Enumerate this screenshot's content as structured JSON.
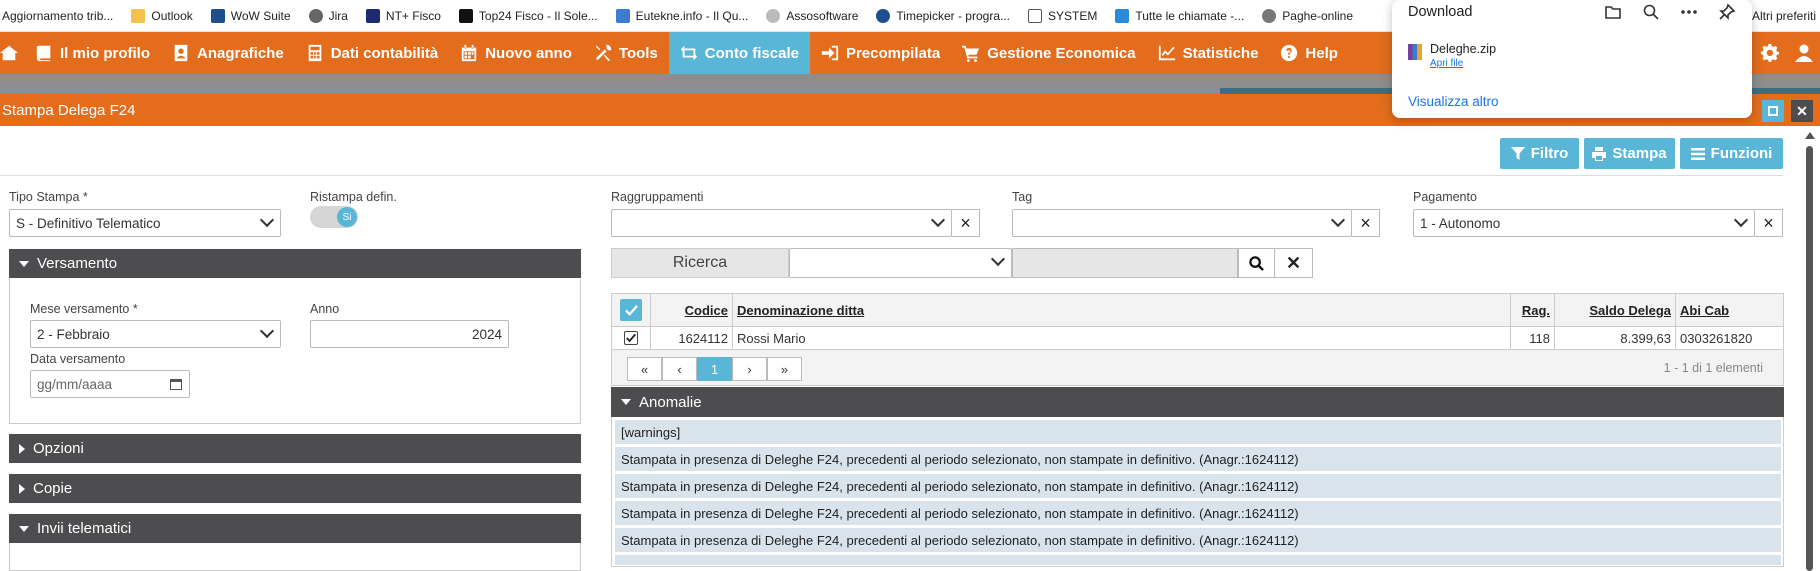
{
  "bookmarks": [
    {
      "label": "Aggiornamento trib...",
      "icon": "none",
      "color": "#ffffff"
    },
    {
      "label": "Outlook",
      "icon": "folder-icon",
      "color": "#f2c14e"
    },
    {
      "label": "WoW Suite",
      "icon": "wow-icon",
      "color": "#1e4e8c"
    },
    {
      "label": "Jira",
      "icon": "globe-icon",
      "color": "#666666"
    },
    {
      "label": "NT+ Fisco",
      "icon": "nt-icon",
      "color": "#1e2a6e"
    },
    {
      "label": "Top24 Fisco - Il Sole...",
      "icon": "sole-icon",
      "color": "#111111"
    },
    {
      "label": "Eutekne.info - Il Qu...",
      "icon": "eutekne-icon",
      "color": "#3d7bd1"
    },
    {
      "label": "Assosoftware",
      "icon": "globe-icon",
      "color": "#999999"
    },
    {
      "label": "Timepicker - progra...",
      "icon": "clock-icon",
      "color": "#1e4e8c"
    },
    {
      "label": "SYSTEM",
      "icon": "doc-icon",
      "color": "#555555"
    },
    {
      "label": "Tutte le chiamate -...",
      "icon": "arrow-icon",
      "color": "#2a8ad8"
    },
    {
      "label": "Paghe-online",
      "icon": "globe-icon",
      "color": "#777777"
    }
  ],
  "bookmarks_right": "Altri preferiti",
  "nav": {
    "items": [
      {
        "label": "Il mio profilo",
        "icon": "book-icon"
      },
      {
        "label": "Anagrafiche",
        "icon": "user-card-icon"
      },
      {
        "label": "Dati contabilità",
        "icon": "calculator-icon"
      },
      {
        "label": "Nuovo anno",
        "icon": "calendar-icon"
      },
      {
        "label": "Tools",
        "icon": "tools-icon"
      },
      {
        "label": "Conto fiscale",
        "icon": "exchange-icon",
        "active": true
      },
      {
        "label": "Precompilata",
        "icon": "sign-in-icon"
      },
      {
        "label": "Gestione Economica",
        "icon": "cart-icon"
      },
      {
        "label": "Statistiche",
        "icon": "line-chart-icon"
      },
      {
        "label": "Help",
        "icon": "question-icon"
      }
    ]
  },
  "window": {
    "title": "Stampa Delega F24"
  },
  "toolbar": {
    "filtro": "Filtro",
    "stampa": "Stampa",
    "funzioni": "Funzioni"
  },
  "form": {
    "tipo_stampa_label": "Tipo Stampa *",
    "tipo_stampa_value": "S - Definitivo Telematico",
    "ristampa_label": "Ristampa defin.",
    "ristampa_toggle": "Si",
    "raggruppamenti_label": "Raggruppamenti",
    "raggruppamenti_value": "",
    "tag_label": "Tag",
    "tag_value": "",
    "pagamento_label": "Pagamento",
    "pagamento_value": "1 - Autonomo"
  },
  "versamento": {
    "title": "Versamento",
    "mese_label": "Mese versamento *",
    "mese_value": "2 - Febbraio",
    "anno_label": "Anno",
    "anno_value": "2024",
    "data_label": "Data versamento",
    "data_placeholder": "gg/mm/aaaa"
  },
  "sections": {
    "opzioni": "Opzioni",
    "copie": "Copie",
    "invii": "Invii telematici"
  },
  "ricerca": {
    "label": "Ricerca",
    "value": ""
  },
  "grid": {
    "headers": {
      "codice": "Codice",
      "denominazione": "Denominazione ditta",
      "rag": "Rag.",
      "saldo": "Saldo Delega",
      "abi": "Abi Cab"
    },
    "rows": [
      {
        "codice": "1624112",
        "denominazione": "Rossi Mario",
        "rag": "118",
        "saldo": "8.399,63",
        "abi": "0303261820"
      }
    ],
    "pager": {
      "first": "«",
      "prev": "‹",
      "page": "1",
      "next": "›",
      "last": "»",
      "info": "1 - 1 di 1 elementi"
    }
  },
  "anomalie": {
    "title": "Anomalie",
    "rows": [
      "[warnings]",
      "Stampata in presenza di Deleghe F24, precedenti al periodo selezionato, non stampate in definitivo. (Anagr.:1624112)",
      "Stampata in presenza di Deleghe F24, precedenti al periodo selezionato, non stampate in definitivo. (Anagr.:1624112)",
      "Stampata in presenza di Deleghe F24, precedenti al periodo selezionato, non stampate in definitivo. (Anagr.:1624112)",
      "Stampata in presenza di Deleghe F24, precedenti al periodo selezionato, non stampate in definitivo. (Anagr.:1624112)"
    ]
  },
  "download": {
    "title": "Download",
    "file_name": "Deleghe.zip",
    "open_link": "Apri file",
    "more_link": "Visualizza altro"
  },
  "colors": {
    "brand_orange": "#e36d1c",
    "accent_blue": "#5ab6d6",
    "section_dark": "#4d4d4f"
  }
}
